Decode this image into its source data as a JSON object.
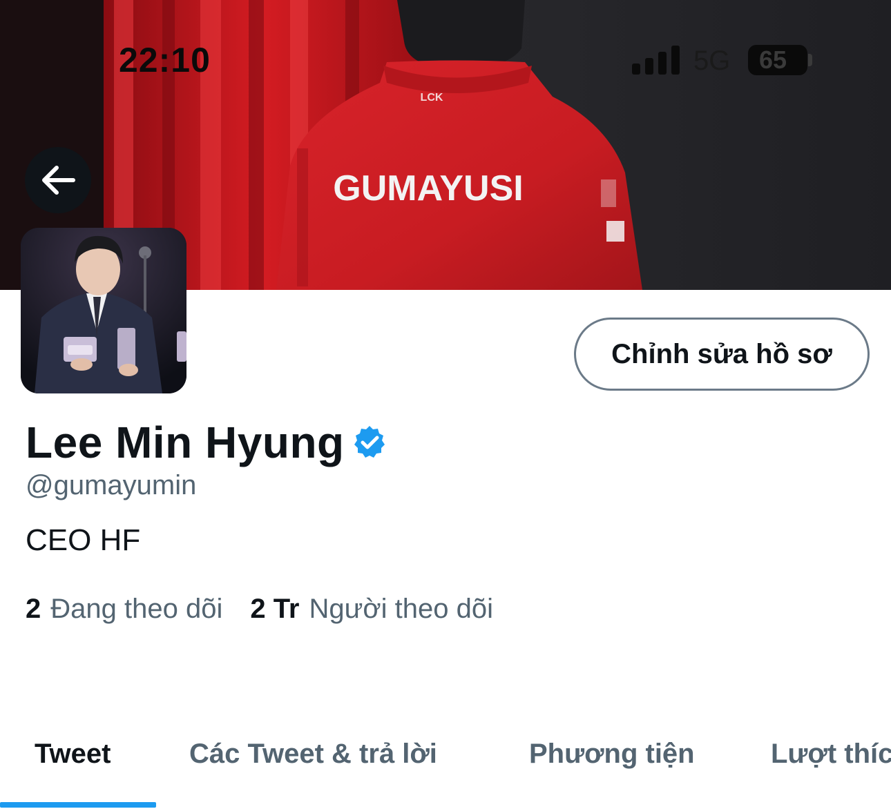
{
  "status_bar": {
    "time": "22:10",
    "network": "5G",
    "battery": "65"
  },
  "banner": {
    "jacket_text": "GUMAYUSI",
    "jacket_logo": "LCK"
  },
  "header": {
    "back_icon": "arrow-left-icon",
    "edit_profile_label": "Chỉnh sửa hồ sơ"
  },
  "profile": {
    "name": "Lee Min Hyung",
    "verified_icon": "verified-badge-icon",
    "verified_color": "#1d9bf0",
    "handle": "@gumayumin",
    "bio": "CEO HF",
    "following_count": "2",
    "following_label": "Đang theo dõi",
    "followers_count": "2 Tr",
    "followers_label": "Người theo dõi"
  },
  "tabs": [
    {
      "label": "Tweet",
      "active": true
    },
    {
      "label": "Các Tweet & trả lời",
      "active": false
    },
    {
      "label": "Phương tiện",
      "active": false
    },
    {
      "label": "Lượt thích",
      "active": false
    }
  ],
  "colors": {
    "accent": "#1d9bf0",
    "text_primary": "#0f1419",
    "text_secondary": "#536471"
  }
}
